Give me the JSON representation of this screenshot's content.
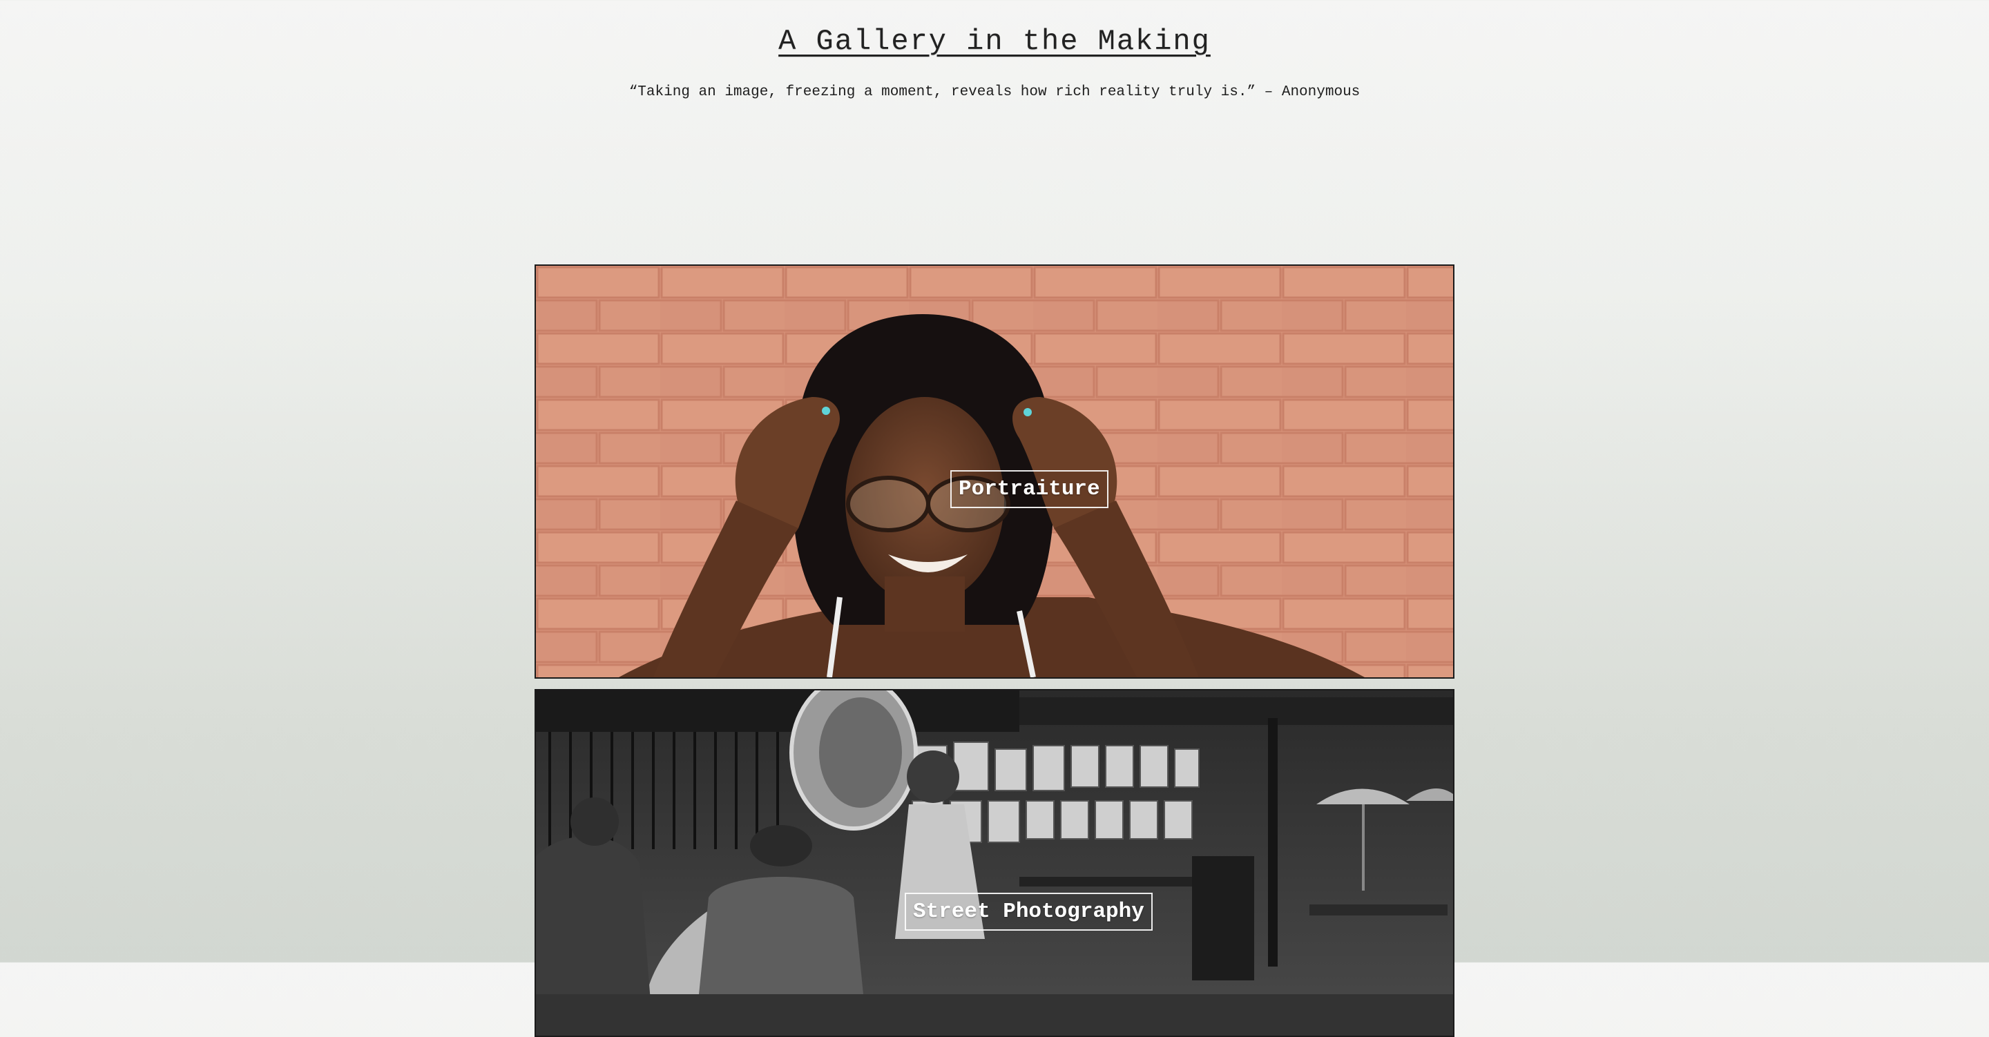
{
  "header": {
    "title": "A Gallery in the Making",
    "quote": "“Taking an image, freezing a moment, reveals how rich reality truly is.” – Anonymous"
  },
  "gallery": {
    "cards": [
      {
        "label": "Portraiture",
        "image": "woman-with-glasses-brick-wall-photo"
      },
      {
        "label": "Street Photography",
        "image": "street-musicians-black-and-white-photo"
      }
    ]
  },
  "colors": {
    "background_top": "#f5f5f4",
    "background_bottom": "#d2d7d1",
    "brick": "#d9957b",
    "border": "#1b1b1b",
    "label_text": "#ffffff"
  }
}
